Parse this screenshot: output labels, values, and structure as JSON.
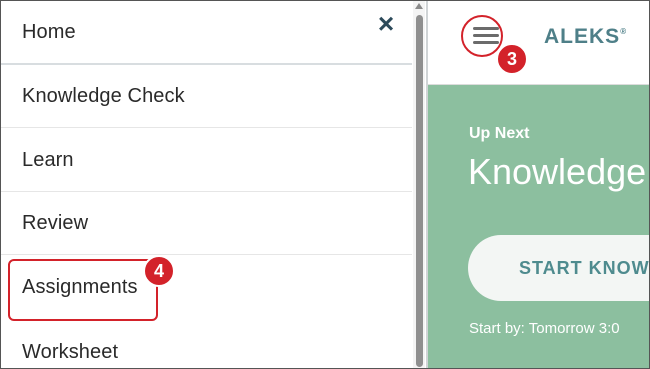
{
  "menu": {
    "items": [
      {
        "label": "Home"
      },
      {
        "label": "Knowledge Check"
      },
      {
        "label": "Learn"
      },
      {
        "label": "Review"
      },
      {
        "label": "Assignments"
      },
      {
        "label": "Worksheet"
      }
    ],
    "close_icon": "×"
  },
  "header": {
    "logo_text": "ALEKS",
    "logo_mark": "®"
  },
  "hero": {
    "up_next": "Up Next",
    "title": "Knowledge",
    "start_button": "START KNOW",
    "start_by": "Start by: Tomorrow 3:0"
  },
  "annotations": {
    "step_hamburger": "3",
    "step_assignments": "4"
  },
  "colors": {
    "accent_green": "#8cbf9f",
    "callout_red": "#d3222a",
    "logo_teal": "#4e7f88"
  }
}
